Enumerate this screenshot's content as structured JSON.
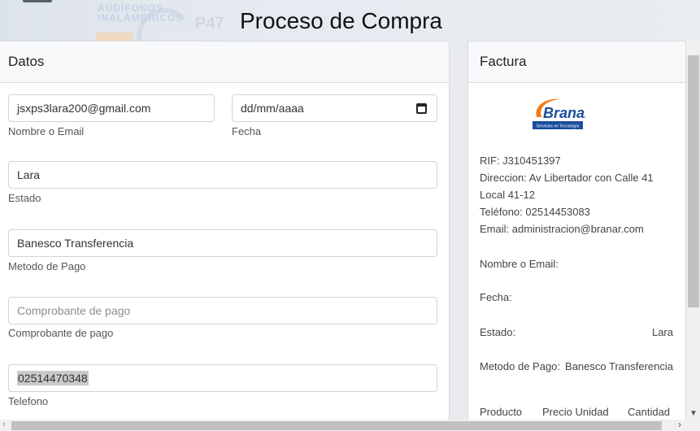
{
  "background": {
    "banner_text_1": "AUDÍFONOS",
    "banner_text_2": "INALÁMBRICOS",
    "banner_code": "P47"
  },
  "page": {
    "title": "Proceso de Compra"
  },
  "datos": {
    "header": "Datos",
    "fields": {
      "nombre": {
        "value": "jsxps3lara200@gmail.com",
        "label": "Nombre o Email"
      },
      "fecha": {
        "value": "dd/mm/aaaa",
        "label": "Fecha"
      },
      "estado": {
        "value": "Lara",
        "label": "Estado"
      },
      "metodo": {
        "value": "Banesco Transferencia",
        "label": "Metodo de Pago"
      },
      "comprobante": {
        "placeholder": "Comprobante de pago",
        "label": "Comprobante de pago"
      },
      "telefono": {
        "value": "02514470348",
        "label": "Telefono"
      }
    }
  },
  "factura": {
    "header": "Factura",
    "logo": {
      "brand": "Branar",
      "tagline": "Servicios en Tecnología"
    },
    "rif": "RIF: J310451397",
    "direccion_1": "Direccion: Av Libertador con Calle 41",
    "direccion_2": "Local 41-12",
    "telefono": "Teléfono: 02514453083",
    "email": "Email: administracion@branar.com",
    "nombre_label": "Nombre o Email:",
    "fecha_label": "Fecha:",
    "estado_label": "Estado:",
    "estado_value": "Lara",
    "metodo_label": "Metodo de Pago:",
    "metodo_value": "Banesco Transferencia",
    "table_headers": [
      "Producto",
      "Precio Unidad",
      "Cantidad"
    ]
  },
  "colors": {
    "logo_blue": "#1a4d9c",
    "logo_orange": "#f07a1a",
    "card_border": "#d6d9dc"
  }
}
